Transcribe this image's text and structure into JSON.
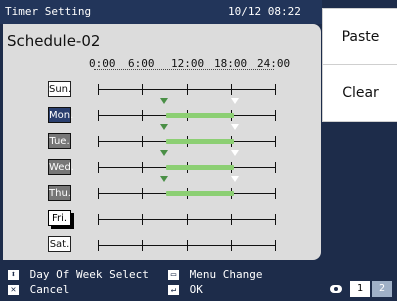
{
  "header": {
    "title": "Timer Setting",
    "datetime": "10/12 08:22"
  },
  "panel": {
    "schedule_title": "Schedule-02"
  },
  "timeline": {
    "labels": [
      "0:00",
      "6:00",
      "12:00",
      "18:00",
      "24:00"
    ]
  },
  "days": [
    {
      "label": "Sun."
    },
    {
      "label": "Mon."
    },
    {
      "label": "Tue."
    },
    {
      "label": "Wed."
    },
    {
      "label": "Thu."
    },
    {
      "label": "Fri."
    },
    {
      "label": "Sat."
    }
  ],
  "side_buttons": {
    "paste": "Paste",
    "clear": "Clear"
  },
  "footer": {
    "day_select": "Day Of Week Select",
    "menu_change": "Menu Change",
    "cancel": "Cancel",
    "ok": "OK"
  },
  "pagination": {
    "page1": "1",
    "page2": "2"
  }
}
